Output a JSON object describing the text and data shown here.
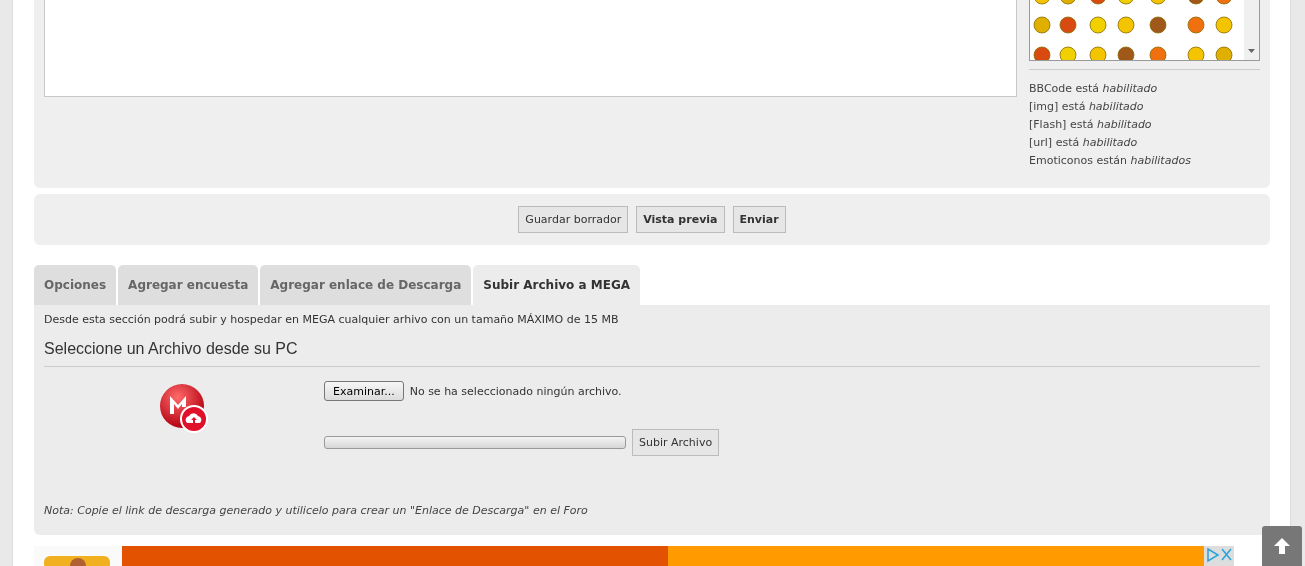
{
  "editor": {
    "status_lines": [
      {
        "label": "BBCode está",
        "value": "habilitado"
      },
      {
        "label": "[img] está",
        "value": "habilitado"
      },
      {
        "label": "[Flash] está",
        "value": "habilitado"
      },
      {
        "label": "[url] está",
        "value": "habilitado"
      },
      {
        "label": "Emoticonos están",
        "value": "habilitados"
      }
    ]
  },
  "buttons": [
    {
      "label": "Guardar borrador",
      "kind": "normal"
    },
    {
      "label": "Vista previa",
      "kind": "bold"
    },
    {
      "label": "Enviar",
      "kind": "bold"
    }
  ],
  "tabs": [
    {
      "label": "Opciones",
      "selected": false
    },
    {
      "label": "Agregar encuesta",
      "selected": false
    },
    {
      "label": "Agregar enlace de Descarga",
      "selected": false
    },
    {
      "label": "Subir Archivo a MEGA",
      "selected": true
    }
  ],
  "upload": {
    "intro": "Desde esta sección podrá subir y hospedar en MEGA cualquier arhivo con un tamaño MÁXIMO de 15 MB",
    "heading": "Seleccione un Archivo desde su PC",
    "browse_button": "Examinar...",
    "file_status": "No se ha seleccionado ningún archivo.",
    "progress": {
      "level": 0
    },
    "upload_button": "Subir Archivo",
    "note": "Nota: Copie el link de descarga generado y utilicelo para crear un \"Enlace de Descarga\" en el Foro"
  }
}
